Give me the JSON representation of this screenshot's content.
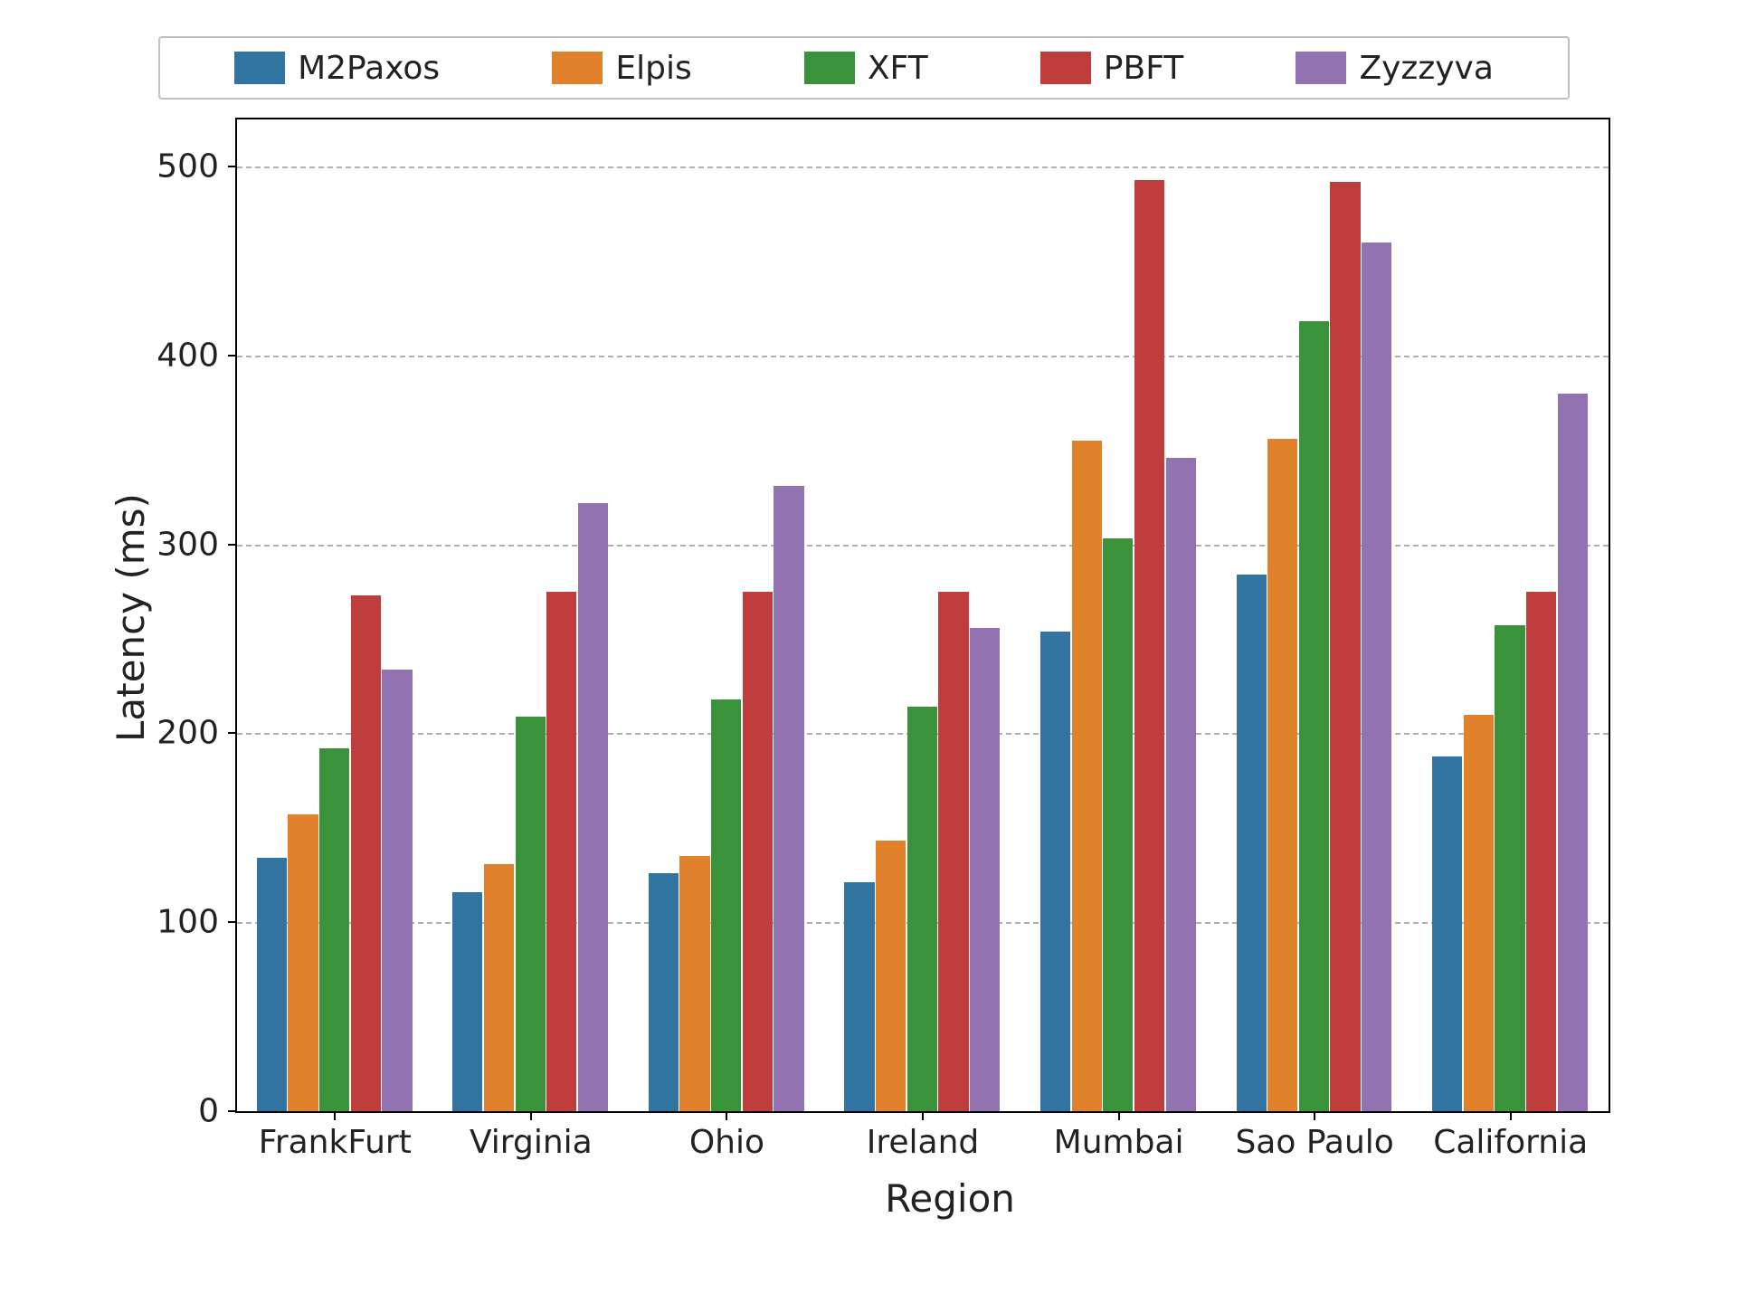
{
  "chart_data": {
    "type": "bar",
    "title": "",
    "xlabel": "Region",
    "ylabel": "Latency (ms)",
    "ylim": [
      0,
      525
    ],
    "yticks": [
      0,
      100,
      200,
      300,
      400,
      500
    ],
    "categories": [
      "FrankFurt",
      "Virginia",
      "Ohio",
      "Ireland",
      "Mumbai",
      "Sao Paulo",
      "California"
    ],
    "series": [
      {
        "name": "M2Paxos",
        "color": "#3274a1",
        "values": [
          134,
          116,
          126,
          121,
          254,
          284,
          188
        ]
      },
      {
        "name": "Elpis",
        "color": "#e1812c",
        "values": [
          157,
          131,
          135,
          143,
          355,
          356,
          210
        ]
      },
      {
        "name": "XFT",
        "color": "#3a923a",
        "values": [
          192,
          209,
          218,
          214,
          303,
          418,
          257
        ]
      },
      {
        "name": "PBFT",
        "color": "#c03d3e",
        "values": [
          273,
          275,
          275,
          275,
          493,
          492,
          275
        ]
      },
      {
        "name": "Zyzzyva",
        "color": "#9372b2",
        "values": [
          234,
          322,
          331,
          256,
          346,
          460,
          380
        ]
      }
    ],
    "legend_position": "top",
    "grid": true
  }
}
